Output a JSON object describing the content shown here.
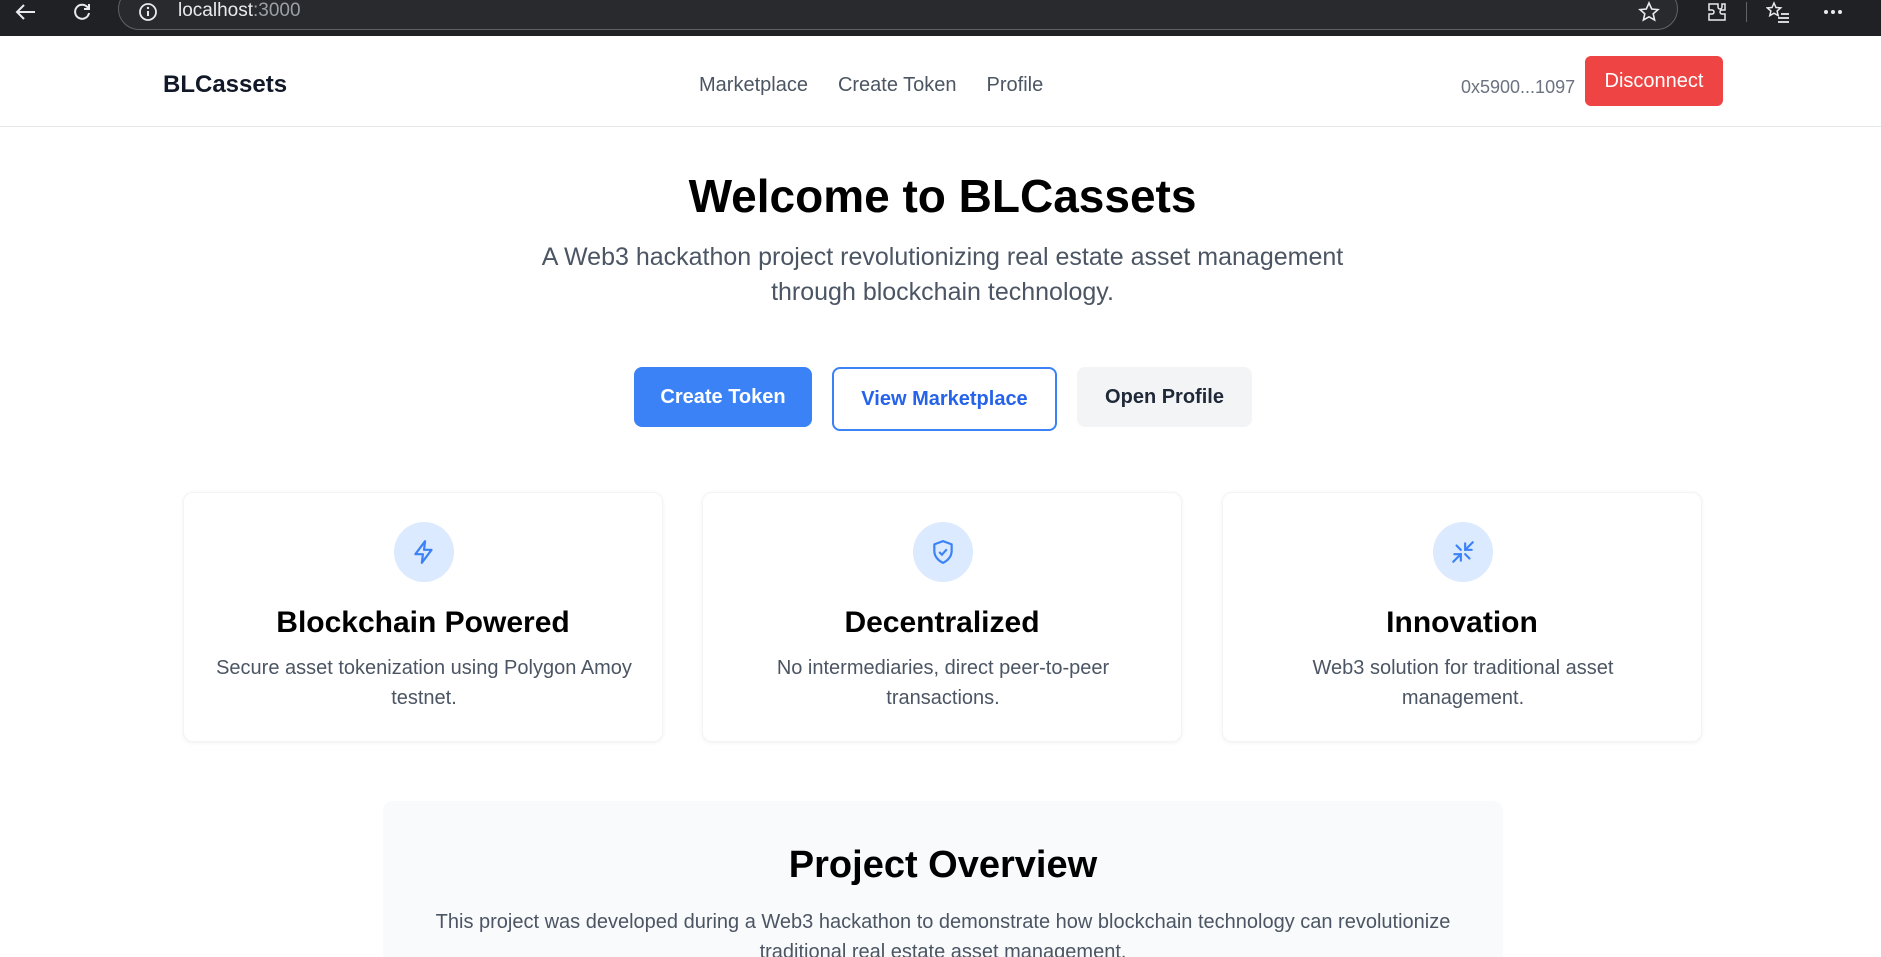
{
  "browser": {
    "url_host": "localhost",
    "url_port": ":3000"
  },
  "nav": {
    "brand": "BLCassets",
    "links": [
      "Marketplace",
      "Create Token",
      "Profile"
    ],
    "wallet": "0x5900...1097",
    "disconnect_label": "Disconnect"
  },
  "hero": {
    "title": "Welcome to BLCassets",
    "subtitle": "A Web3 hackathon project revolutionizing real estate asset management through blockchain technology.",
    "buttons": {
      "create": "Create Token",
      "marketplace": "View Marketplace",
      "profile": "Open Profile"
    }
  },
  "features": [
    {
      "icon": "lightning-icon",
      "title": "Blockchain Powered",
      "desc": "Secure asset tokenization using Polygon Amoy testnet."
    },
    {
      "icon": "shield-check-icon",
      "title": "Decentralized",
      "desc": "No intermediaries, direct peer-to-peer transactions."
    },
    {
      "icon": "collapse-arrows-icon",
      "title": "Innovation",
      "desc": "Web3 solution for traditional asset management."
    }
  ],
  "overview": {
    "title": "Project Overview",
    "text": "This project was developed during a Web3 hackathon to demonstrate how blockchain technology can revolutionize traditional real estate asset management."
  },
  "colors": {
    "primary": "#3b82f6",
    "danger": "#ef4444",
    "icon_bg": "#dbeafe"
  }
}
